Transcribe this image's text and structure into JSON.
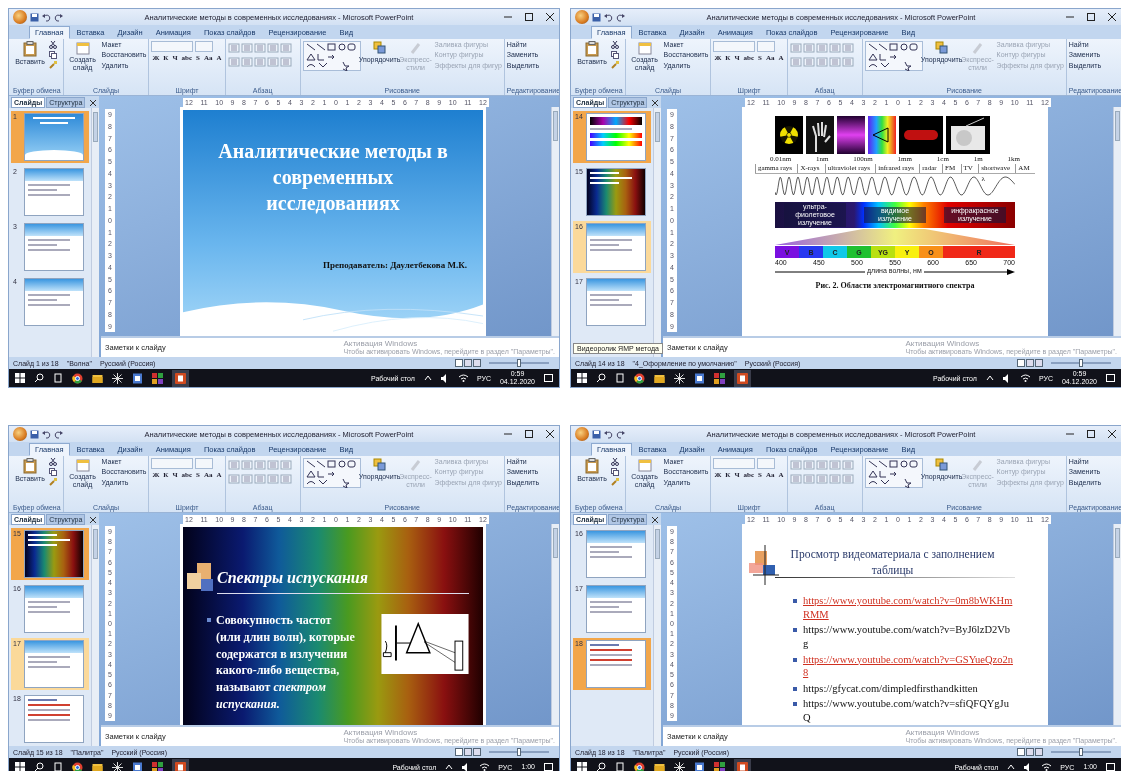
{
  "windows": [
    {
      "title": "Аналитические методы в современных исследованиях - Microsoft PowerPoint",
      "tabs": [
        {
          "label": "Главная",
          "selected": true
        },
        {
          "label": "Вставка",
          "selected": false
        },
        {
          "label": "Дизайн",
          "selected": false
        },
        {
          "label": "Анимация",
          "selected": false
        },
        {
          "label": "Показ слайдов",
          "selected": false
        },
        {
          "label": "Рецензирование",
          "selected": false
        },
        {
          "label": "Вид",
          "selected": false
        }
      ],
      "ribbon": [
        {
          "kind": "clipboard",
          "label": "Буфер обмена",
          "big": "Вставить"
        },
        {
          "kind": "slides",
          "label": "Слайды",
          "big": "Создать слайд",
          "small": [
            "Макет",
            "Восстановить",
            "Удалить"
          ]
        },
        {
          "kind": "font",
          "label": "Шрифт",
          "format": [
            "Ж",
            "К",
            "Ч",
            "abc",
            "S",
            "Aa",
            "A"
          ]
        },
        {
          "kind": "paragraph",
          "label": "Абзац"
        },
        {
          "kind": "drawing",
          "label": "Рисование",
          "big": "Упорядочить",
          "styles": "Экспресс-стили",
          "small": [
            "Заливка фигуры",
            "Контур фигуры",
            "Эффекты для фигур"
          ]
        },
        {
          "kind": "editing",
          "label": "Редактирование",
          "small": [
            "Найти",
            "Заменить",
            "Выделить"
          ]
        }
      ],
      "pane_tabs": [
        {
          "label": "Слайды",
          "selected": true
        },
        {
          "label": "Структура",
          "selected": false
        }
      ],
      "thumbnails": [
        {
          "number": "1",
          "kind": "title",
          "selected": true,
          "highlighted": false
        },
        {
          "number": "2",
          "kind": "header",
          "selected": false,
          "highlighted": false
        },
        {
          "number": "3",
          "kind": "header",
          "selected": false,
          "highlighted": false
        },
        {
          "number": "4",
          "kind": "header",
          "selected": false,
          "highlighted": false
        }
      ],
      "ruler_h": [
        "12",
        "11",
        "10",
        "9",
        "8",
        "7",
        "6",
        "5",
        "4",
        "3",
        "2",
        "1",
        "0",
        "1",
        "2",
        "3",
        "4",
        "5",
        "6",
        "7",
        "8",
        "9",
        "10",
        "11",
        "12"
      ],
      "ruler_v": [
        "9",
        "8",
        "7",
        "6",
        "5",
        "4",
        "3",
        "2",
        "1",
        "0",
        "1",
        "2",
        "3",
        "4",
        "5",
        "6",
        "7",
        "8",
        "9"
      ],
      "slide": {
        "kind": "title",
        "title": "Аналитические методы в современных исследованиях",
        "subtitle": "Преподаватель: Даулетбекова М.К."
      },
      "notes_placeholder": "Заметки к слайду",
      "activation": {
        "title": "Активация Windows",
        "text": "Чтобы активировать Windows, перейдите в раздел \"Параметры\"."
      },
      "status": {
        "slide": "Слайд 1 из 18",
        "theme": "\"Волна\"",
        "language": "Русский (Россия)"
      },
      "zoom": {
        "level": 0.5
      },
      "taskbar": {
        "desktop": "Рабочий стол",
        "language": "РУС",
        "time": "0:59",
        "date": "04.12.2020"
      }
    },
    {
      "title": "Аналитические методы в современных исследованиях - Microsoft PowerPoint",
      "tabs": [
        {
          "label": "Главная",
          "selected": true
        },
        {
          "label": "Вставка",
          "selected": false
        },
        {
          "label": "Дизайн",
          "selected": false
        },
        {
          "label": "Анимация",
          "selected": false
        },
        {
          "label": "Показ слайдов",
          "selected": false
        },
        {
          "label": "Рецензирование",
          "selected": false
        },
        {
          "label": "Вид",
          "selected": false
        }
      ],
      "ribbon": [
        {
          "kind": "clipboard",
          "label": "Буфер обмена",
          "big": "Вставить"
        },
        {
          "kind": "slides",
          "label": "Слайды",
          "big": "Создать слайд",
          "small": [
            "Макет",
            "Восстановить",
            "Удалить"
          ]
        },
        {
          "kind": "font",
          "label": "Шрифт",
          "format": [
            "Ж",
            "К",
            "Ч",
            "abc",
            "S",
            "Aa",
            "A"
          ]
        },
        {
          "kind": "paragraph",
          "label": "Абзац"
        },
        {
          "kind": "drawing",
          "label": "Рисование",
          "big": "Упорядочить",
          "styles": "Экспресс-стили",
          "small": [
            "Заливка фигуры",
            "Контур фигуры",
            "Эффекты для фигур"
          ]
        },
        {
          "kind": "editing",
          "label": "Редактирование",
          "small": [
            "Найти",
            "Заменить",
            "Выделить"
          ]
        }
      ],
      "pane_tabs": [
        {
          "label": "Слайды",
          "selected": true
        },
        {
          "label": "Структура",
          "selected": false
        }
      ],
      "thumbnails": [
        {
          "number": "14",
          "kind": "spectrum",
          "selected": true,
          "highlighted": false
        },
        {
          "number": "15",
          "kind": "emission",
          "selected": false,
          "highlighted": false
        },
        {
          "number": "16",
          "kind": "header",
          "selected": false,
          "highlighted": true
        },
        {
          "number": "17",
          "kind": "header",
          "selected": false,
          "highlighted": false
        }
      ],
      "tooltip": "Видеоролик ЯМР метода",
      "ruler_h": [
        "12",
        "11",
        "10",
        "9",
        "8",
        "7",
        "6",
        "5",
        "4",
        "3",
        "2",
        "1",
        "0",
        "1",
        "2",
        "3",
        "4",
        "5",
        "6",
        "7",
        "8",
        "9",
        "10",
        "11",
        "12"
      ],
      "ruler_v": [
        "9",
        "8",
        "7",
        "6",
        "5",
        "4",
        "3",
        "2",
        "1",
        "0",
        "1",
        "2",
        "3",
        "4",
        "5",
        "6",
        "7",
        "8",
        "9"
      ],
      "slide": {
        "kind": "spectrum",
        "wavelengths": [
          "0.01nm",
          "1nm",
          "100nm",
          "1mm",
          "1cm",
          "1m",
          "1km"
        ],
        "bands": [
          "gamma rays",
          "X-rays",
          "ultraviolet rays",
          "infrared rays",
          "radar",
          "FM",
          "TV",
          "shortwave",
          "AM"
        ],
        "wave_label": "λ",
        "regions": [
          "ультра-фиолетовое излучение",
          "видимое излучение",
          "инфракрасное излучение"
        ],
        "colors": [
          {
            "label": "V",
            "color": "#7a10e0"
          },
          {
            "label": "B",
            "color": "#2838f0"
          },
          {
            "label": "C",
            "color": "#10c8e8"
          },
          {
            "label": "G",
            "color": "#20c030"
          },
          {
            "label": "YG",
            "color": "#b8e010"
          },
          {
            "label": "Y",
            "color": "#f8f010"
          },
          {
            "label": "O",
            "color": "#f89018"
          },
          {
            "label": "R",
            "color": "#f02818"
          }
        ],
        "axis": [
          "400",
          "450",
          "500",
          "550",
          "600",
          "650",
          "700"
        ],
        "axis_label": "длина волны, нм",
        "caption": "Рис. 2. Области электромагнитного спектра"
      },
      "notes_placeholder": "Заметки к слайду",
      "activation": {
        "title": "Активация Windows",
        "text": "Чтобы активировать Windows, перейдите в раздел \"Параметры\"."
      },
      "status": {
        "slide": "Слайд 14 из 18",
        "theme": "\"4_Оформление по умолчанию\"",
        "language": "Русский (Россия)"
      },
      "zoom": {
        "level": 0.5
      },
      "taskbar": {
        "desktop": "Рабочий стол",
        "language": "РУС",
        "time": "0:59",
        "date": "04.12.2020"
      }
    },
    {
      "title": "Аналитические методы в современных исследованиях - Microsoft PowerPoint",
      "tabs": [
        {
          "label": "Главная",
          "selected": true
        },
        {
          "label": "Вставка",
          "selected": false
        },
        {
          "label": "Дизайн",
          "selected": false
        },
        {
          "label": "Анимация",
          "selected": false
        },
        {
          "label": "Показ слайдов",
          "selected": false
        },
        {
          "label": "Рецензирование",
          "selected": false
        },
        {
          "label": "Вид",
          "selected": false
        }
      ],
      "ribbon": [
        {
          "kind": "clipboard",
          "label": "Буфер обмена",
          "big": "Вставить"
        },
        {
          "kind": "slides",
          "label": "Слайды",
          "big": "Создать слайд",
          "small": [
            "Макет",
            "Восстановить",
            "Удалить"
          ]
        },
        {
          "kind": "font",
          "label": "Шрифт",
          "format": [
            "Ж",
            "К",
            "Ч",
            "abc",
            "S",
            "Aa",
            "A"
          ]
        },
        {
          "kind": "paragraph",
          "label": "Абзац"
        },
        {
          "kind": "drawing",
          "label": "Рисование",
          "big": "Упорядочить",
          "styles": "Экспресс-стили",
          "small": [
            "Заливка фигуры",
            "Контур фигуры",
            "Эффекты для фигур"
          ]
        },
        {
          "kind": "editing",
          "label": "Редактирование",
          "small": [
            "Найти",
            "Заменить",
            "Выделить"
          ]
        }
      ],
      "pane_tabs": [
        {
          "label": "Слайды",
          "selected": true
        },
        {
          "label": "Структура",
          "selected": false
        }
      ],
      "thumbnails": [
        {
          "number": "15",
          "kind": "emission",
          "selected": true,
          "highlighted": false
        },
        {
          "number": "16",
          "kind": "header",
          "selected": false,
          "highlighted": false
        },
        {
          "number": "17",
          "kind": "header",
          "selected": false,
          "highlighted": true
        },
        {
          "number": "18",
          "kind": "links",
          "selected": false,
          "highlighted": false
        }
      ],
      "ruler_h": [
        "12",
        "11",
        "10",
        "9",
        "8",
        "7",
        "6",
        "5",
        "4",
        "3",
        "2",
        "1",
        "0",
        "1",
        "2",
        "3",
        "4",
        "5",
        "6",
        "7",
        "8",
        "9",
        "10",
        "11",
        "12"
      ],
      "ruler_v": [
        "9",
        "8",
        "7",
        "6",
        "5",
        "4",
        "3",
        "2",
        "1",
        "0",
        "1",
        "2",
        "3",
        "4",
        "5",
        "6",
        "7",
        "8",
        "9"
      ],
      "slide": {
        "kind": "emission",
        "title": "Спектры испускания",
        "body": "Совокупность частот (или длин волн), которые содержатся в излучении какого-либо вещества, называют *спектром испускания.*"
      },
      "notes_placeholder": "Заметки к слайду",
      "activation": {
        "title": "Активация Windows",
        "text": "Чтобы активировать Windows, перейдите в раздел \"Параметры\"."
      },
      "status": {
        "slide": "Слайд 15 из 18",
        "theme": "\"Палитра\"",
        "language": "Русский (Россия)"
      },
      "zoom": {
        "level": 0.5
      },
      "taskbar": {
        "desktop": "Рабочий стол",
        "language": "РУС",
        "time": "1:00"
      }
    },
    {
      "title": "Аналитические методы в современных исследованиях - Microsoft PowerPoint",
      "tabs": [
        {
          "label": "Главная",
          "selected": true
        },
        {
          "label": "Вставка",
          "selected": false
        },
        {
          "label": "Дизайн",
          "selected": false
        },
        {
          "label": "Анимация",
          "selected": false
        },
        {
          "label": "Показ слайдов",
          "selected": false
        },
        {
          "label": "Рецензирование",
          "selected": false
        },
        {
          "label": "Вид",
          "selected": false
        }
      ],
      "ribbon": [
        {
          "kind": "clipboard",
          "label": "Буфер обмена",
          "big": "Вставить"
        },
        {
          "kind": "slides",
          "label": "Слайды",
          "big": "Создать слайд",
          "small": [
            "Макет",
            "Восстановить",
            "Удалить"
          ]
        },
        {
          "kind": "font",
          "label": "Шрифт",
          "format": [
            "Ж",
            "К",
            "Ч",
            "abc",
            "S",
            "Aa",
            "A"
          ]
        },
        {
          "kind": "paragraph",
          "label": "Абзац"
        },
        {
          "kind": "drawing",
          "label": "Рисование",
          "big": "Упорядочить",
          "styles": "Экспресс-стили",
          "small": [
            "Заливка фигуры",
            "Контур фигуры",
            "Эффекты для фигур"
          ]
        },
        {
          "kind": "editing",
          "label": "Редактирование",
          "small": [
            "Найти",
            "Заменить",
            "Выделить"
          ]
        }
      ],
      "pane_tabs": [
        {
          "label": "Слайды",
          "selected": true
        },
        {
          "label": "Структура",
          "selected": false
        }
      ],
      "thumbnails": [
        {
          "number": "16",
          "kind": "header",
          "selected": false,
          "highlighted": false
        },
        {
          "number": "17",
          "kind": "header",
          "selected": false,
          "highlighted": false
        },
        {
          "number": "18",
          "kind": "links",
          "selected": true,
          "highlighted": false
        }
      ],
      "ruler_h": [
        "12",
        "11",
        "10",
        "9",
        "8",
        "7",
        "6",
        "5",
        "4",
        "3",
        "2",
        "1",
        "0",
        "1",
        "2",
        "3",
        "4",
        "5",
        "6",
        "7",
        "8",
        "9",
        "10",
        "11",
        "12"
      ],
      "ruler_v": [
        "9",
        "8",
        "7",
        "6",
        "5",
        "4",
        "3",
        "2",
        "1",
        "0",
        "1",
        "2",
        "3",
        "4",
        "5",
        "6",
        "7",
        "8",
        "9"
      ],
      "slide": {
        "kind": "links",
        "title": "Просмотр видеоматериала с заполнением таблицы",
        "items": [
          {
            "text": "https://www.youtube.com/watch?v=0m8bWKHmRMM",
            "linked": true
          },
          {
            "text": "https://www.youtube.com/watch?v=ByJ6lzD2Vbg",
            "linked": false
          },
          {
            "text": "https://www.youtube.com/watch?v=GSYueQzo2n8",
            "linked": true
          },
          {
            "text": "https://gfycat.com/dimpledfirsthandkitten",
            "linked": false
          },
          {
            "text": "https://www.youtube.com/watch?v=sfiQFQYgJuQ",
            "linked": false
          }
        ]
      },
      "notes_placeholder": "Заметки к слайду",
      "activation": {
        "title": "Активация Windows",
        "text": "Чтобы активировать Windows, перейдите в раздел \"Параметры\"."
      },
      "status": {
        "slide": "Слайд 18 из 18",
        "theme": "\"Палитра\"",
        "language": "Русский (Россия)"
      },
      "zoom": {
        "level": 0.5
      },
      "taskbar": {
        "desktop": "Рабочий стол",
        "language": "РУС",
        "time": "1:00"
      }
    }
  ]
}
